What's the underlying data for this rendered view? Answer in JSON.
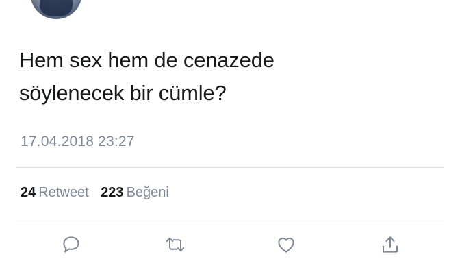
{
  "tweet": {
    "text_line1": "Hem sex hem de cenazede",
    "text_line2": "söylenecek bir cümle?",
    "timestamp": "17.04.2018 23:27"
  },
  "stats": {
    "retweet_count": "24",
    "retweet_label": "Retweet",
    "like_count": "223",
    "like_label": "Beğeni"
  },
  "actions": {
    "icons": [
      "reply-icon",
      "retweet-icon",
      "like-icon",
      "share-icon"
    ],
    "icon_color": "#7d8894"
  },
  "colors": {
    "text": "#16191c",
    "secondary": "#7d8894",
    "divider": "#e3e7ea",
    "background": "#ffffff"
  }
}
